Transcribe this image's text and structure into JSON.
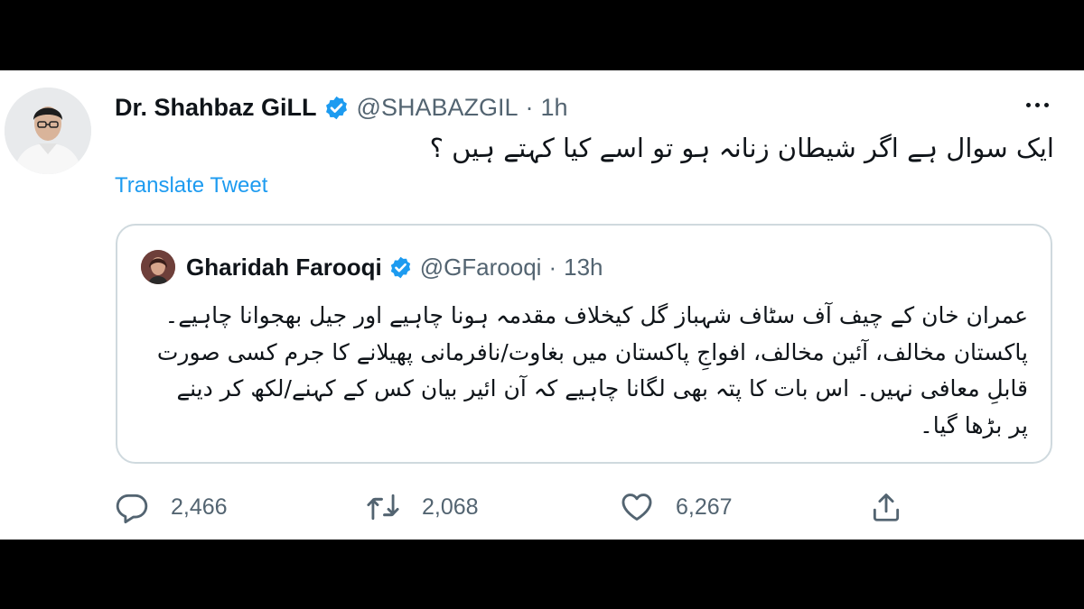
{
  "tweet": {
    "author_name": "Dr. Shahbaz GiLL",
    "handle": "@SHABAZGIL",
    "separator": "·",
    "time": "1h",
    "text": "ایک سوال ہے اگر شیطان زنانہ ہو تو اسے کیا کہتے ہیں ؟",
    "translate_label": "Translate Tweet"
  },
  "quoted": {
    "author_name": "Gharidah Farooqi",
    "handle": "@GFarooqi",
    "separator": "·",
    "time": "13h",
    "text": "عمران خان کے چیف آف سٹاف شہباز گل کیخلاف مقدمہ ہونا چاہیے اور جیل بھجوانا چاہیے۔ پاکستان مخالف، آئین مخالف، افواجِ پاکستان میں بغاوت/نافرمانی پھیلانے کا جرم کسی صورت قابلِ معافی نہیں۔ اس بات کا پتہ بھی لگانا چاہیے کہ آن ائیر بیان کس کے کہنے/لکھ کر دینے پر بڑھا گیا۔"
  },
  "actions": {
    "replies": "2,466",
    "retweets": "2,068",
    "likes": "6,267"
  },
  "icons": {
    "verified": "verified-badge-icon",
    "more": "more-options-icon",
    "reply": "reply-icon",
    "retweet": "retweet-icon",
    "like": "like-icon",
    "share": "share-icon"
  },
  "colors": {
    "accent": "#1d9bf0",
    "text_primary": "#0f1419",
    "text_secondary": "#536471",
    "border": "#cfd9de",
    "letterbox": "#000000"
  }
}
